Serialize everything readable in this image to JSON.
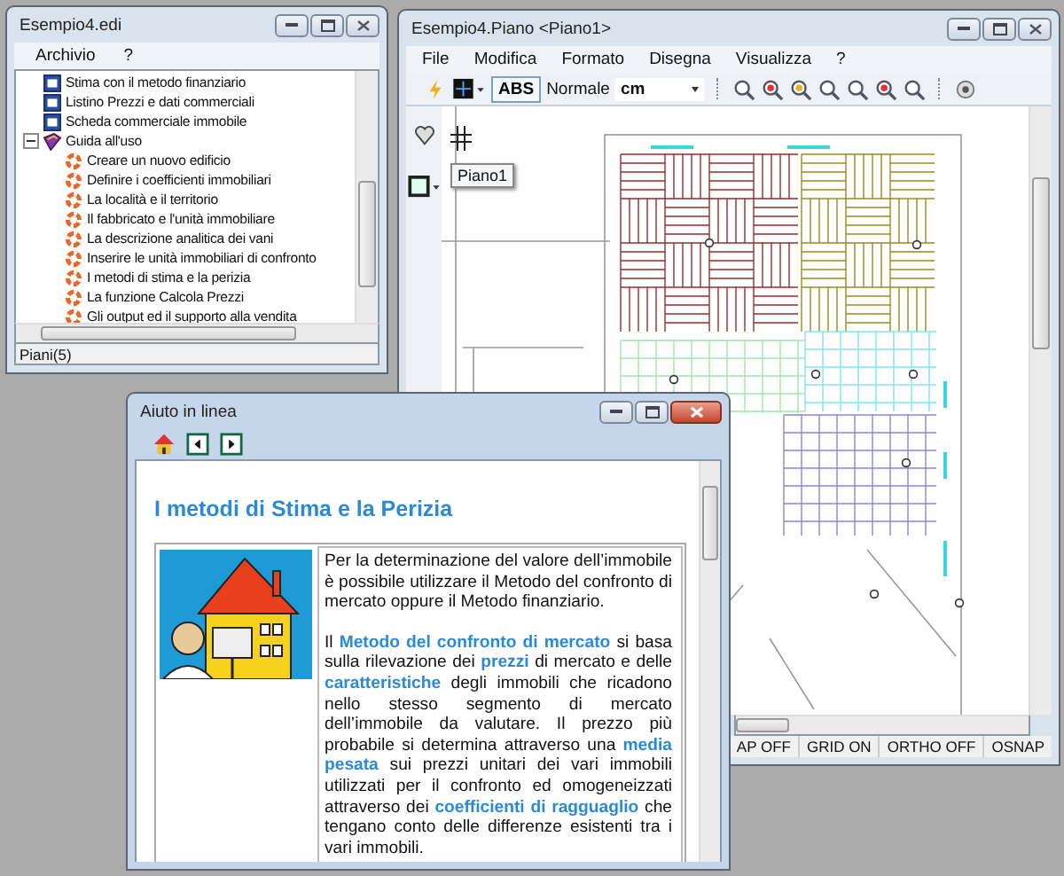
{
  "tree_window": {
    "title": "Esempio4.edi",
    "menu": [
      "Archivio",
      "?"
    ],
    "tree": [
      {
        "label": "Stima con il metodo finanziario",
        "kind": "doc"
      },
      {
        "label": "Listino Prezzi e dati commerciali",
        "kind": "doc"
      },
      {
        "label": "Scheda commerciale immobile",
        "kind": "doc"
      },
      {
        "label": "Guida all'uso",
        "kind": "book",
        "expanded": true,
        "children": [
          {
            "label": "Creare un nuovo edificio",
            "kind": "topic"
          },
          {
            "label": "Definire i coefficienti immobiliari",
            "kind": "topic"
          },
          {
            "label": "La località e il territorio",
            "kind": "topic"
          },
          {
            "label": "Il fabbricato e l'unità immobiliare",
            "kind": "topic"
          },
          {
            "label": "La descrizione analitica dei vani",
            "kind": "topic"
          },
          {
            "label": "Inserire le unità immobiliari di confronto",
            "kind": "topic"
          },
          {
            "label": "I metodi di stima e la perizia",
            "kind": "topic"
          },
          {
            "label": "La funzione Calcola Prezzi",
            "kind": "topic"
          },
          {
            "label": "Gli output ed il supporto alla vendita",
            "kind": "topic"
          }
        ]
      }
    ],
    "status": "Piani(5)"
  },
  "plan_window": {
    "title": "Esempio4.Piano <Piano1>",
    "menu": [
      "File",
      "Modifica",
      "Formato",
      "Disegna",
      "Visualizza",
      "?"
    ],
    "toolbar": {
      "mode": "ABS",
      "style": "Normale",
      "unit": "cm"
    },
    "tooltip": "Piano1",
    "status": [
      "AP OFF",
      "GRID ON",
      "ORTHO OFF",
      "OSNAP"
    ]
  },
  "help_window": {
    "title": "Aiuto in linea",
    "heading": "I metodi di Stima e la Perizia",
    "paragraphs": [
      "Per la determinazione del valore dell’immobile è possibile utilizzare il Metodo del confronto di mercato oppure il Metodo finanziario.",
      "Il **Metodo del confronto di mercato** si basa sulla rilevazione dei **prezzi** di mercato e delle **caratteristiche** degli immobili che ricadono nello stesso segmento di mercato dell’immobile da valutare. Il prezzo più probabile si determina attraverso una **media pesata** sui prezzi unitari dei vari immobili utilizzati per il confronto ed omogeneizzati attraverso dei **coefficienti di ragguaglio** che tengano conto delle differenze esistenti tra i vari immobili."
    ]
  }
}
